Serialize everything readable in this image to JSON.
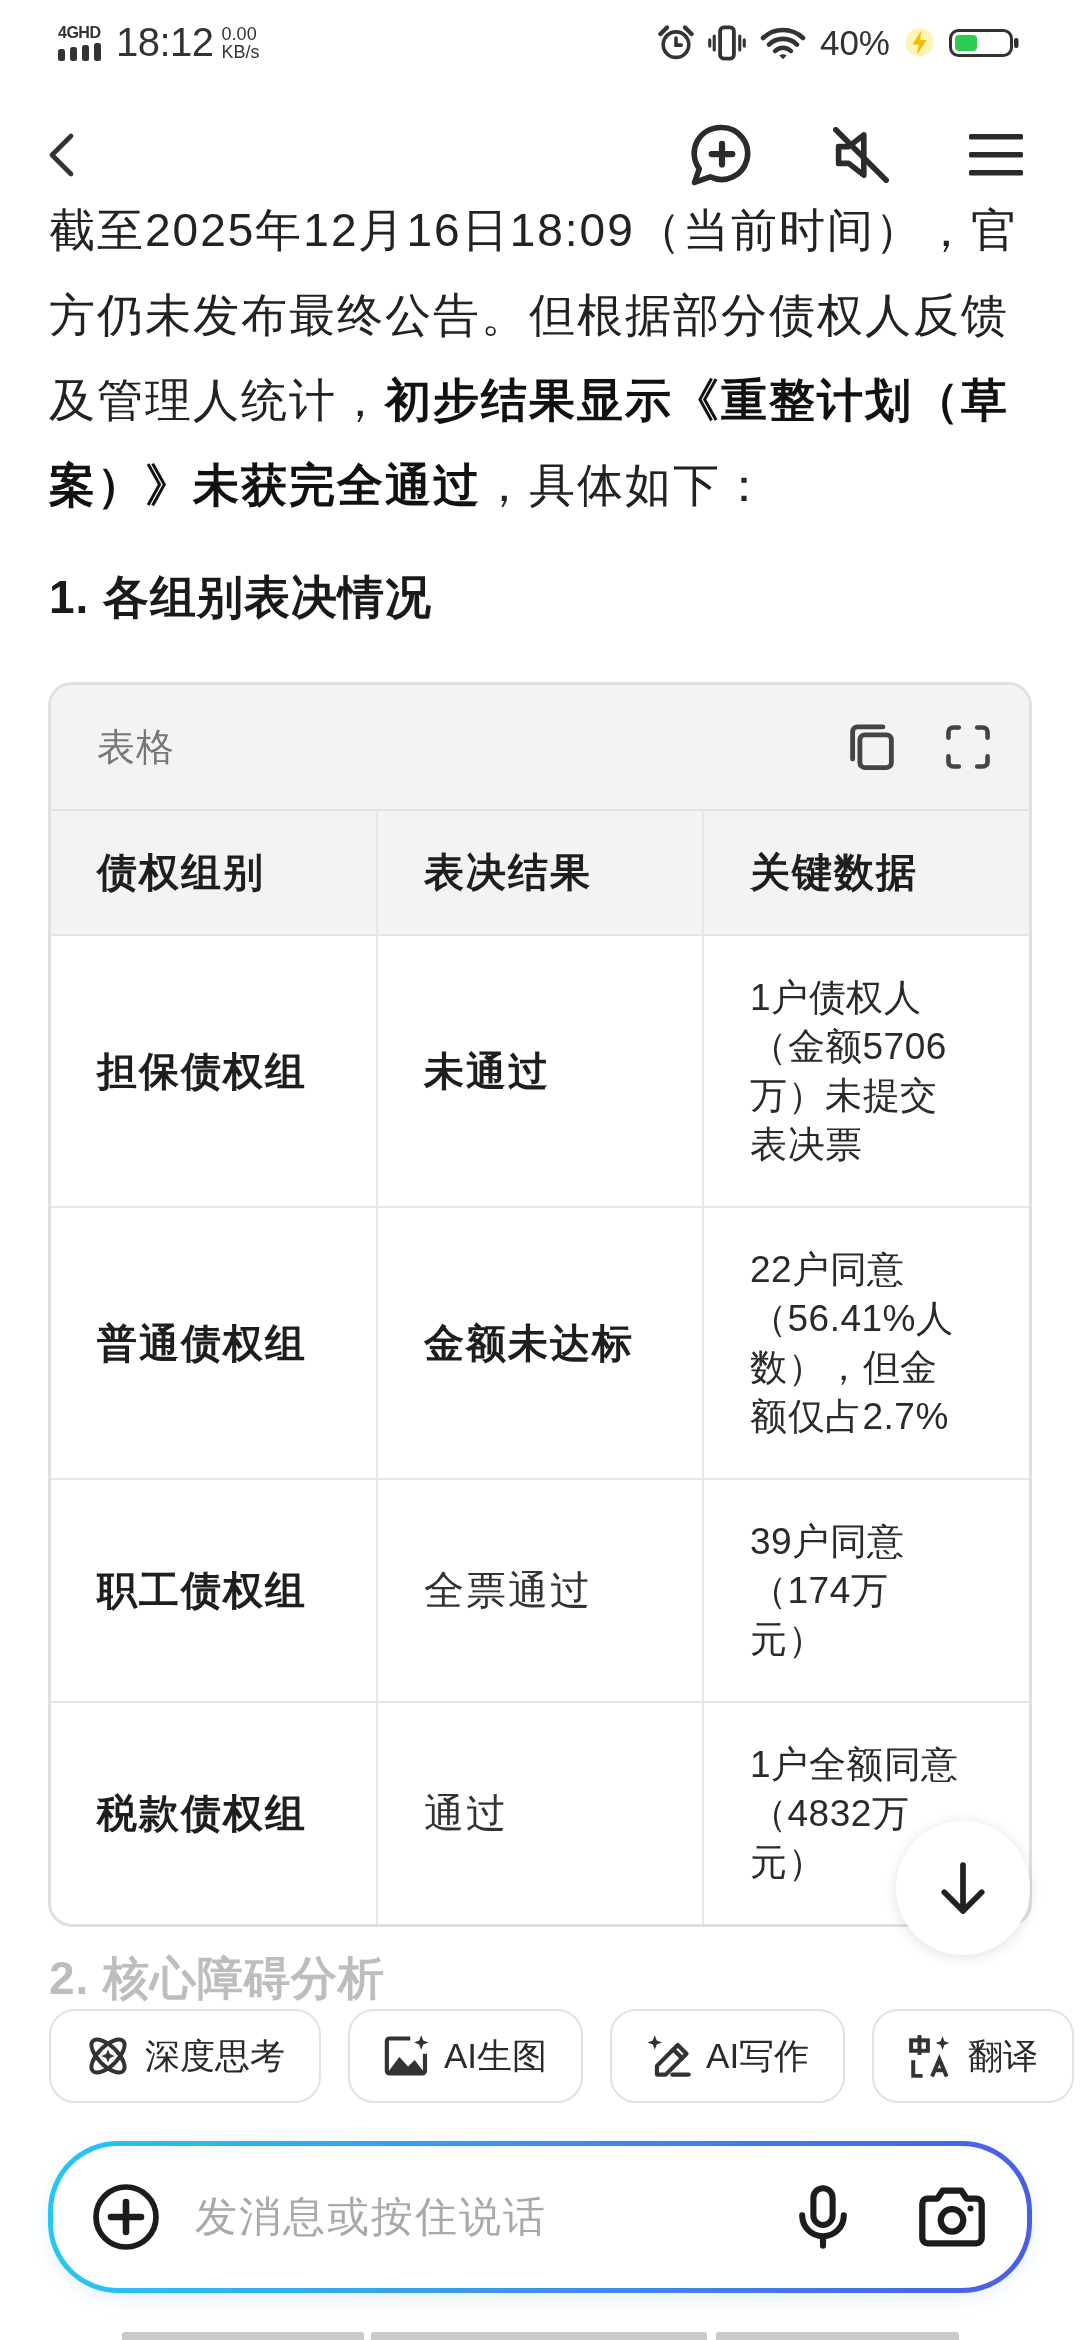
{
  "status_bar": {
    "network": "4GHD",
    "time": "18:12",
    "speed_value": "0.00",
    "speed_unit": "KB/s",
    "battery": "40%"
  },
  "article": {
    "paragraph": "截至2025年12月16日18:09（当前时间），官方仍未发布最终公告。但根据部分债权人反馈及管理人统计，**初步结果显示《重整计划（草案）》未获完全通过**，具体如下：",
    "heading": "1. 各组别表决情况"
  },
  "table": {
    "title": "表格",
    "columns": [
      "债权组别",
      "表决结果",
      "关键数据"
    ],
    "rows": [
      {
        "group": "担保债权组",
        "result": "未通过",
        "result_bold": true,
        "key_data": "1户债权人（金额5706万）未提交表决票"
      },
      {
        "group": "普通债权组",
        "result": "金额未达标",
        "result_bold": true,
        "key_data": "22户同意（56.41%人数），但金额仅占2.7%"
      },
      {
        "group": "职工债权组",
        "result": "全票通过",
        "result_bold": false,
        "key_data": "39户同意（174万元）"
      },
      {
        "group": "税款债权组",
        "result": "通过",
        "result_bold": false,
        "key_data": "1户全额同意（4832万元）"
      }
    ]
  },
  "next_heading": "2. 核心障碍分析",
  "chips": [
    {
      "label": "深度思考"
    },
    {
      "label": "AI生图"
    },
    {
      "label": "AI写作"
    },
    {
      "label": "翻译"
    }
  ],
  "composer": {
    "placeholder": "发消息或按住说话"
  }
}
